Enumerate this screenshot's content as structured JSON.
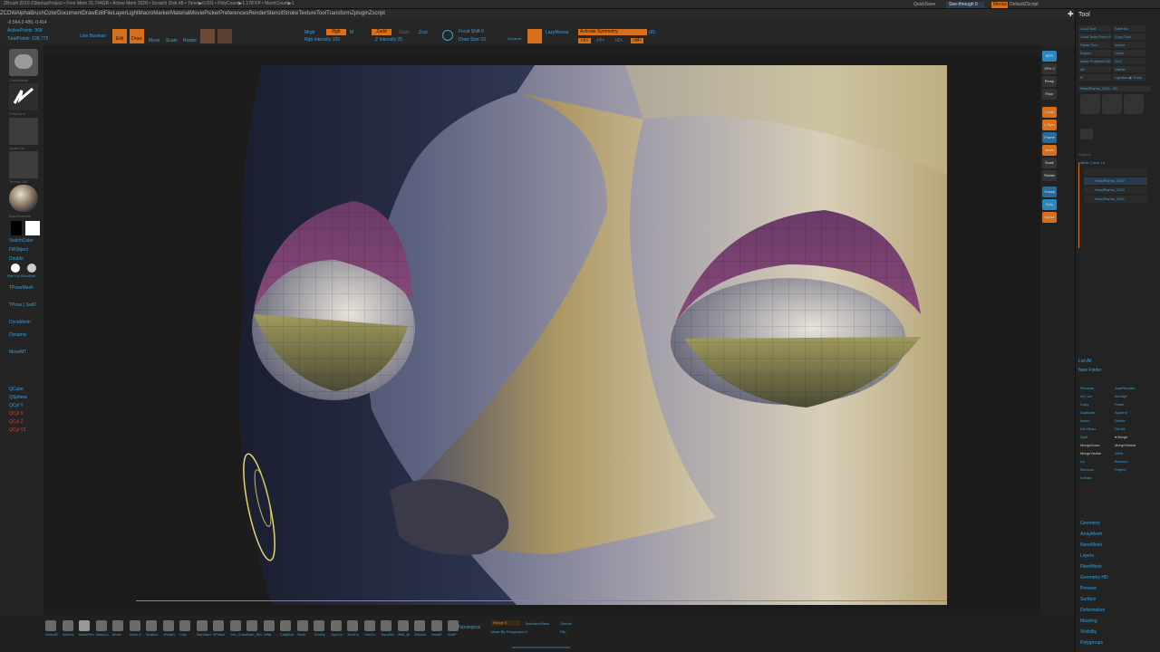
{
  "app": {
    "status_line": "ZBrush 2019   ZStartupProject  • Free Mem 15.744GB • Active Mem 1028 • Scratch Disk 48 • Timer▶0.001 • PolyCount▶1.178 KP • MeshCount▶1"
  },
  "menu": [
    "ZCDW",
    "Alpha",
    "Brush",
    "Color",
    "Document",
    "Draw",
    "Edit",
    "File",
    "Layer",
    "Light",
    "Macro",
    "Marker",
    "Material",
    "Movie",
    "Picker",
    "Preferences",
    "Render",
    "Stencil",
    "Stroke",
    "Texture",
    "Tool",
    "Transform",
    "Zplugin",
    "Zscript"
  ],
  "top_right": {
    "quicksave": "QuickSave",
    "seethrough": "See-through  0",
    "menus": "Menus",
    "script": "DefaultZScript"
  },
  "info": {
    "coords": "-0.564,0.489,-0.414",
    "active_points": "ActivePoints: 968",
    "total_points": "TotalPoints: 108,772",
    "live_boolean": "Live Boolean"
  },
  "toolbar": {
    "edit": "Edit",
    "draw": "Draw",
    "move": "Move",
    "scale": "Scale",
    "rotate": "Rotate",
    "mrgb": "Mrgb",
    "rgb": "Rgb",
    "m": "M",
    "zadd": "Zadd",
    "zsub": "Zsub",
    "zcut": "Zcut",
    "rgb_intensity": "Rgb Intensity 100",
    "z_intensity": "Z Intensity 25",
    "focal_shift": "Focal Shift 0",
    "draw_size": "Draw Size 33",
    "dynamic": "Dynamic",
    "lazymouse": "LazyMouse",
    "activate_symmetry": "Activate Symmetry",
    "x": ">X<",
    "y": ">Y<",
    "z": ">Z<",
    "m2": ">M<",
    "r": "(R)"
  },
  "left": {
    "brush_name": "ClayBuildup",
    "stroke_name": "FreeHand",
    "alpha_name": "Alpha Off",
    "texture_name": "Texture Off",
    "material_name": "BasicMaterial",
    "switch_color": "SwitchColor",
    "fill_object": "FillObject",
    "double": "Double",
    "flat_color": "Flat Col Skin/Shd",
    "tpose_mesh": "TPoseMesh",
    "tpose_subt": "TPose | SubT",
    "dynamesh": "DynaMesh",
    "dynamic": "Dynamic",
    "move_mt": "MoveMT",
    "qcube": "QCube",
    "qsphere": "QSphere",
    "qcyl": "QCyl Y",
    "qcyl_x": "QCyl X",
    "qcyl_z": "QCyl Z",
    "qcyl_y2": "QCyl Y2"
  },
  "right_shelf": [
    "BPR",
    "SPix 3",
    "Persp",
    "Floor",
    "Local",
    "L.Sym",
    "Frame",
    "Move",
    "Scale",
    "Rotate",
    "Transp",
    "Solo",
    "Xpose"
  ],
  "tool": {
    "title": "Tool",
    "buttons": [
      "Load Tool",
      "Save As",
      "Load Tools From Project",
      "Copy Tool",
      "Paste Tool",
      "Import",
      "Export",
      "Clone",
      "Make PolyMesh3D",
      "GoZ",
      "All",
      "Visible",
      "R",
      "Lightbox ▶ Tools"
    ],
    "current": "HeadPlanes_2021 . 90",
    "subtools_header": "Subtool",
    "visible_count": "Visible Count 15",
    "subtools": [
      "",
      "HeadPlanes_2019",
      "HeadPlanes_2020",
      "HeadPlanes_2021"
    ],
    "list_all": "List All",
    "new_folder": "New Folder",
    "actions": [
      "Rename",
      "AutoReorder",
      "All Low",
      "All High",
      "Copy",
      "Paste",
      "Duplicate",
      "Append",
      "Insert",
      "Delete",
      "Del Other",
      "Del All",
      "Split",
      "▾ Merge",
      "MergeDown",
      "MergeSimilar",
      "MergeVisible",
      "Weld",
      "Uv",
      "Boolean",
      "Remesh",
      "Project",
      "Extract"
    ],
    "sections": [
      "Geometry",
      "ArrayMesh",
      "NanoMesh",
      "Layers",
      "FiberMesh",
      "Geometry HD",
      "Preview",
      "Surface",
      "Deformation",
      "Masking",
      "Visibility",
      "Polygroups"
    ]
  },
  "bottom": {
    "brushes": [
      "SelectR",
      "SelectL",
      "MaskPen",
      "MaskLa",
      "Move",
      "Move E",
      "Snakeh",
      "hPolish",
      "Clay",
      "Standard",
      "hPolish",
      "Orb_Cracks",
      "Dam_Std",
      "Inflat",
      "ClayBuil",
      "Pinch",
      "TrimDy",
      "ClipCur",
      "TrimCu",
      "TrimCu",
      "TopoWa",
      "IMM_Bi",
      "ZModel",
      "HandP",
      "SnkP"
    ],
    "topological": "Topological",
    "range": "Range 5",
    "backface": "BackfaceMask",
    "double": "Double",
    "mask_polygroup": "Mask By Polygroups 0",
    "flip": "Flip"
  },
  "colors": {
    "accent_orange": "#e07a1e",
    "accent_blue": "#3aa0d8",
    "cursor_yellow": "#e8d46a"
  }
}
